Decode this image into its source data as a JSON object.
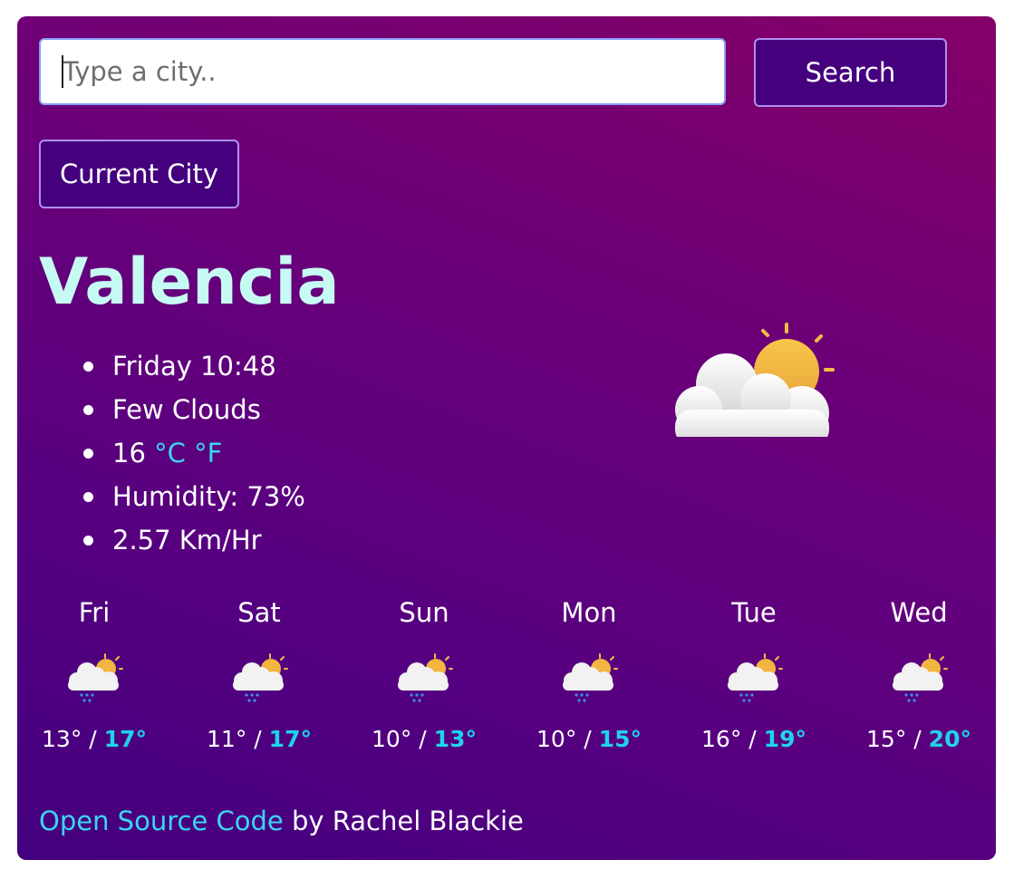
{
  "search": {
    "placeholder": "Type a city..",
    "value": "",
    "button_label": "Search"
  },
  "current_city_button": "Current City",
  "city": "Valencia",
  "details": {
    "datetime": "Friday 10:48",
    "description": "Few Clouds",
    "temperature": "16",
    "unit_celsius": "°C",
    "unit_fahrenheit": "°F",
    "humidity": "Humidity: 73%",
    "wind": "2.57 Km/Hr"
  },
  "main_icon": "few-clouds-icon",
  "forecast": [
    {
      "day": "Fri",
      "min": "13°",
      "max": "17°",
      "icon": "rain-cloud-sun-icon"
    },
    {
      "day": "Sat",
      "min": "11°",
      "max": "17°",
      "icon": "rain-cloud-sun-icon"
    },
    {
      "day": "Sun",
      "min": "10°",
      "max": "13°",
      "icon": "rain-cloud-sun-icon"
    },
    {
      "day": "Mon",
      "min": "10°",
      "max": "15°",
      "icon": "rain-cloud-sun-icon"
    },
    {
      "day": "Tue",
      "min": "16°",
      "max": "19°",
      "icon": "rain-cloud-sun-icon"
    },
    {
      "day": "Wed",
      "min": "15°",
      "max": "20°",
      "icon": "rain-cloud-sun-icon"
    }
  ],
  "footer": {
    "link_label": "Open Source Code",
    "text": "by Rachel Blackie"
  },
  "colors": {
    "background_top": "#850068",
    "background_bottom": "#43007e",
    "city_title": "#c6fbf3",
    "accent_link": "#3ad6f0",
    "max_temp": "#1fd3ea",
    "button_bg": "#45007e",
    "button_border": "#b08ef2"
  }
}
